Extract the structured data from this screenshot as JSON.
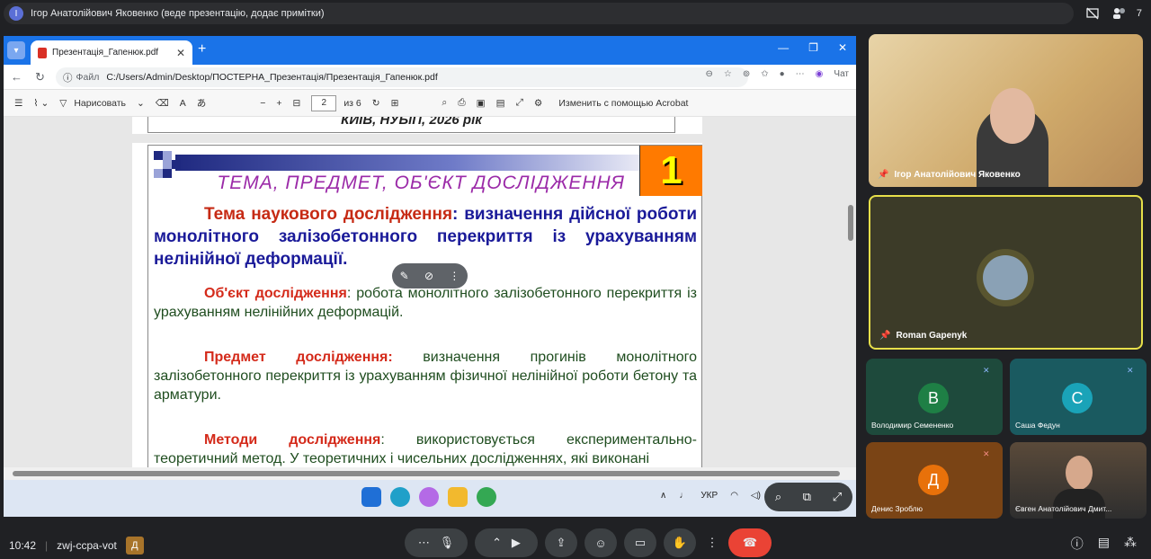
{
  "meet": {
    "presenter_initial": "І",
    "presenter_text": "Ігор Анатолійович Яковенко (веде презентацію, додає примітки)",
    "participant_count": "7",
    "time": "10:42",
    "meeting_code": "zwj-ccpa-vot",
    "badge_letter": "Д"
  },
  "browser": {
    "tab_title": "Презентація_Гапенюк.pdf",
    "address_label": "Файл",
    "address": "C:/Users/Admin/Desktop/ПОСТЕРНА_Презентація/Презентація_Гапенюк.pdf",
    "chat_label": "Чат"
  },
  "pdf_toolbar": {
    "draw_label": "Нарисовать",
    "page_value": "2",
    "page_of": "из 6",
    "acrobat_label": "Изменить с помощью Acrobat"
  },
  "pdf": {
    "prev_page_text": "КИЇВ, НУБіП, 2026 рік",
    "slide_number": "1",
    "slide_title": "ТЕМА, ПРЕДМЕТ, ОБ'ЄКТ ДОСЛІДЖЕННЯ",
    "topic_label": "Тема наукового дослідження",
    "topic_text": ": визначення дійсної роботи монолітного залізобетонного перекриття із урахуванням нелінійної деформації.",
    "object_label": "Об'єкт дослідження",
    "object_text": ": робота монолітного залізобетонного перекриття із урахуванням нелінійних деформацій.",
    "subject_label": "Предмет дослідження:",
    "subject_text": " визначення прогинів монолітного залізобетонного перекриття із урахуванням фізичної нелінійної роботи бетону та арматури.",
    "methods_label": "Методи дослідження",
    "methods_text": ": використовується експериментально-теоретичний метод. У теоретичних і чисельних дослідженнях, які виконані"
  },
  "taskbar": {
    "lang": "УКР"
  },
  "participants": [
    {
      "name": "Ігор Анатолійович Яковенко"
    },
    {
      "name": "Roman Gapenyk"
    },
    {
      "name": "Володимир Семененко",
      "initial": "В",
      "color": "#1e7f45"
    },
    {
      "name": "Саша Федун",
      "initial": "С",
      "color": "#1aa3b8"
    },
    {
      "name": "Денис Зроблю",
      "initial": "Д",
      "color": "#e8710a"
    },
    {
      "name": "Євген Анатолійович Дмит..."
    }
  ],
  "colors": {
    "meet_bg": "#202124",
    "accent_blue": "#1a73e8",
    "end_call_red": "#ea4335",
    "slide_orange": "#ff7a00"
  }
}
